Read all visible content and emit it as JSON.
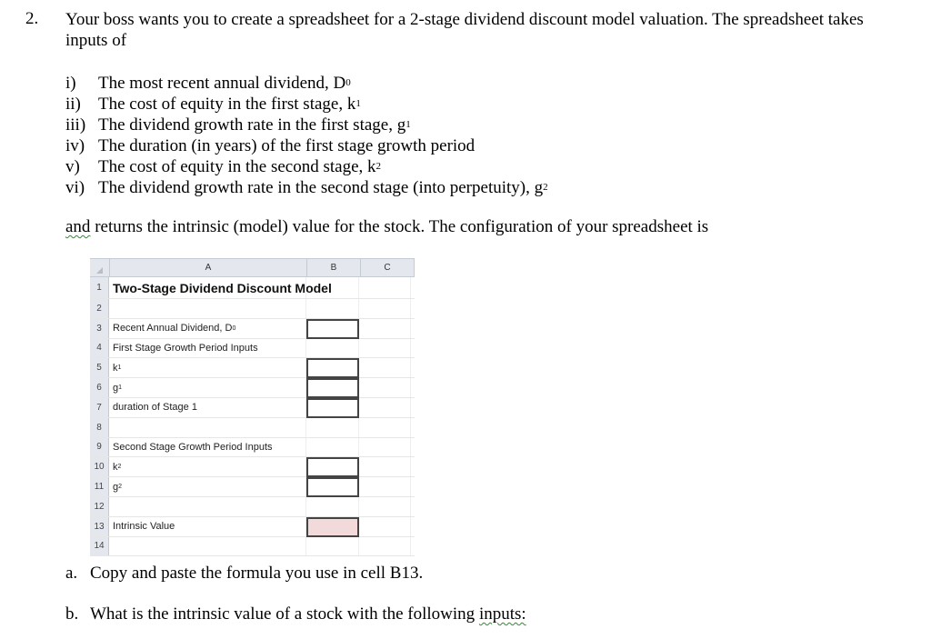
{
  "question": {
    "number": "2.",
    "intro": "Your boss wants you to create a spreadsheet for a 2-stage dividend discount model valuation.  The spreadsheet takes inputs of",
    "inputs": [
      {
        "label": "i)",
        "text": "The most recent annual dividend, D",
        "sub": "0"
      },
      {
        "label": "ii)",
        "text": "The cost of equity in the first stage, k",
        "sub": "1"
      },
      {
        "label": "iii)",
        "text": "The dividend growth rate in the first stage, g",
        "sub": "1"
      },
      {
        "label": "iv)",
        "text": "The duration (in years) of the first stage growth period",
        "sub": ""
      },
      {
        "label": "v)",
        "text": "The cost of equity in the second stage, k",
        "sub": "2"
      },
      {
        "label": "vi)",
        "text": "The dividend growth rate in the second stage (into perpetuity), g",
        "sub": "2"
      }
    ],
    "returns_first_word": "and",
    "returns_rest": " returns the intrinsic (model) value for the stock.  The configuration of your spreadsheet is",
    "part_a_label": "a.",
    "part_a_text": "Copy and paste the formula you use in cell B13.",
    "part_b_label": "b.",
    "part_b_text": "What is the intrinsic value of a stock with the following ",
    "part_b_last_word": "inputs:"
  },
  "spreadsheet": {
    "columns": [
      "A",
      "B",
      "C"
    ],
    "rows": [
      {
        "num": "1",
        "a": "Two-Stage Dividend Discount Model",
        "a_sub": "",
        "input": "none"
      },
      {
        "num": "2",
        "a": "",
        "a_sub": "",
        "input": "none"
      },
      {
        "num": "3",
        "a": "Recent Annual Dividend, D",
        "a_sub": "0",
        "input": "box"
      },
      {
        "num": "4",
        "a": "First Stage Growth Period Inputs",
        "a_sub": "",
        "input": "none"
      },
      {
        "num": "5",
        "a": "k",
        "a_sub": "1",
        "input": "box"
      },
      {
        "num": "6",
        "a": "g",
        "a_sub": "1",
        "input": "box"
      },
      {
        "num": "7",
        "a": "duration of Stage 1",
        "a_sub": "",
        "input": "box"
      },
      {
        "num": "8",
        "a": "",
        "a_sub": "",
        "input": "none"
      },
      {
        "num": "9",
        "a": "Second Stage Growth Period Inputs",
        "a_sub": "",
        "input": "none"
      },
      {
        "num": "10",
        "a": "k",
        "a_sub": "2",
        "input": "box"
      },
      {
        "num": "11",
        "a": "g",
        "a_sub": "2",
        "input": "box"
      },
      {
        "num": "12",
        "a": "",
        "a_sub": "",
        "input": "none"
      },
      {
        "num": "13",
        "a": "Intrinsic Value",
        "a_sub": "",
        "input": "output"
      },
      {
        "num": "14",
        "a": "",
        "a_sub": "",
        "input": "none"
      }
    ],
    "output_fill_color": "#f2d9da"
  }
}
